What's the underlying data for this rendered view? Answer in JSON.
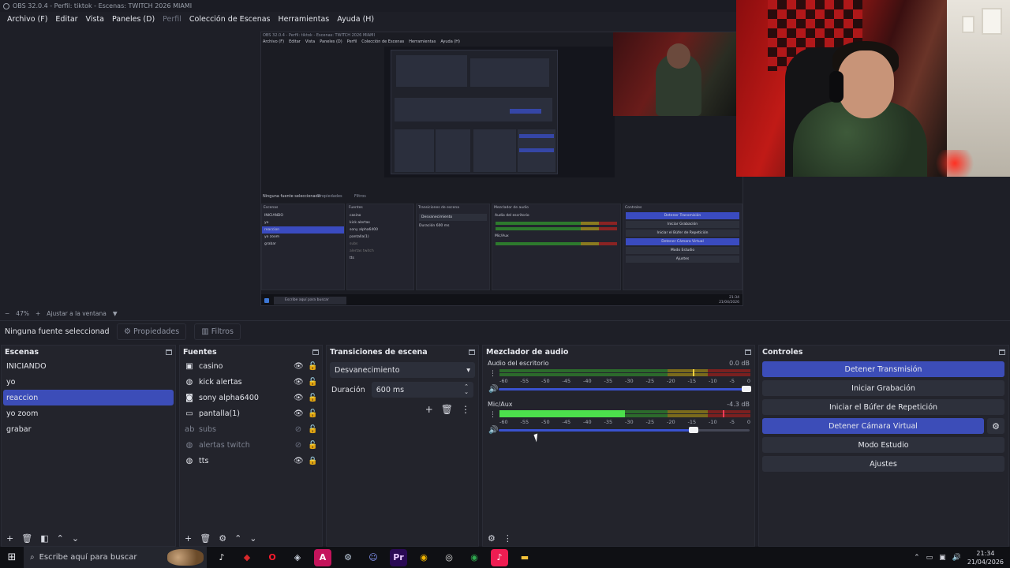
{
  "window": {
    "title": "OBS 32.0.4 - Perfil: tiktok - Escenas: TWITCH 2026 MIAMI"
  },
  "menu": [
    {
      "label": "Archivo (F)",
      "enabled": true
    },
    {
      "label": "Editar",
      "enabled": true
    },
    {
      "label": "Vista",
      "enabled": true
    },
    {
      "label": "Paneles (D)",
      "enabled": true
    },
    {
      "label": "Perfil",
      "enabled": false
    },
    {
      "label": "Colección de Escenas",
      "enabled": true
    },
    {
      "label": "Herramientas",
      "enabled": true
    },
    {
      "label": "Ayuda (H)",
      "enabled": true
    }
  ],
  "nested": {
    "title": "OBS 32.0.4 - Perfil: tiktok - Escenas: TWITCH 2026 MIAMI",
    "menu": [
      "Archivo (F)",
      "Editar",
      "Vista",
      "Paneles (D)",
      "Perfil",
      "Colección de Escenas",
      "Herramientas",
      "Ayuda (H)"
    ],
    "no_source": "Ninguna fuente seleccionada",
    "props": "Propiedades",
    "filters": "Filtros",
    "scenes_title": "Escenas",
    "scenes": [
      "INICIANDO",
      "yo",
      "reaccion",
      "yo zoom",
      "grabar"
    ],
    "sources_title": "Fuentes",
    "sources": [
      "casino",
      "kick alertas",
      "sony alpha6400",
      "pantalla(1)",
      "subs",
      "alertas twitch",
      "tts"
    ],
    "trans_title": "Transiciones de escena",
    "trans_value": "Desvanecimiento",
    "dur_label": "Duración",
    "dur_value": "600 ms",
    "mixer_title": "Mezclador de audio",
    "ch1": "Audio del escritorio",
    "ch2": "Mic/Aux",
    "controls_title": "Controles",
    "controls": [
      "Detener Transmisión",
      "Iniciar Grabación",
      "Iniciar el Búfer de Repetición",
      "Detener Cámara Virtual",
      "Modo Estudio",
      "Ajustes"
    ],
    "search": "Escribe aquí para buscar",
    "time": "21:34",
    "date": "21/04/2026"
  },
  "zoom": {
    "minus": "−",
    "value": "47%",
    "plus": "+",
    "fit": "Ajustar a la ventana",
    "caret": "▼"
  },
  "source_toolbar": {
    "status": "Ninguna fuente seleccionada",
    "properties": "Propiedades",
    "filters": "Filtros"
  },
  "scenes": {
    "title": "Escenas",
    "items": [
      "INICIANDO",
      "yo",
      "reaccion",
      "yo zoom",
      "grabar"
    ],
    "selected_index": 2
  },
  "sources": {
    "title": "Fuentes",
    "items": [
      {
        "name": "casino",
        "icon": "globe",
        "visible": true,
        "locked": false
      },
      {
        "name": "kick alertas",
        "icon": "globe",
        "visible": true,
        "locked": false
      },
      {
        "name": "sony alpha6400",
        "icon": "camera",
        "visible": true,
        "locked": false
      },
      {
        "name": "pantalla(1)",
        "icon": "monitor",
        "visible": true,
        "locked": false
      },
      {
        "name": "subs",
        "icon": "text",
        "visible": false,
        "locked": false
      },
      {
        "name": "alertas twitch",
        "icon": "globe",
        "visible": false,
        "locked": false
      },
      {
        "name": "tts",
        "icon": "globe",
        "visible": true,
        "locked": true
      }
    ]
  },
  "transitions": {
    "title": "Transiciones de escena",
    "type": "Desvanecimiento",
    "duration_label": "Duración",
    "duration_value": "600 ms"
  },
  "mixer": {
    "title": "Mezclador de audio",
    "ticks": [
      "-60",
      "-55",
      "-50",
      "-45",
      "-40",
      "-35",
      "-30",
      "-25",
      "-20",
      "-15",
      "-10",
      "-5",
      "0"
    ],
    "channels": [
      {
        "name": "Audio del escritorio",
        "db": "0.0 dB",
        "level": 0.0,
        "volume": 1.0
      },
      {
        "name": "Mic/Aux",
        "db": "-4.3 dB",
        "level": 0.5,
        "volume": 0.79
      }
    ]
  },
  "controls": {
    "title": "Controles",
    "stop_stream": "Detener Transmisión",
    "start_record": "Iniciar Grabación",
    "replay_buffer": "Iniciar el Búfer de Repetición",
    "stop_vcam": "Detener Cámara Virtual",
    "studio_mode": "Modo Estudio",
    "settings": "Ajustes"
  },
  "taskbar": {
    "search_placeholder": "Escribe aquí para buscar",
    "apps": [
      {
        "name": "tiktok",
        "glyph": "♪",
        "color": "#ffffff",
        "bg": "transparent"
      },
      {
        "name": "razer",
        "glyph": "◆",
        "color": "#d8282b",
        "bg": "transparent"
      },
      {
        "name": "opera",
        "glyph": "O",
        "color": "#ff1b2d",
        "bg": "transparent"
      },
      {
        "name": "app",
        "glyph": "◈",
        "color": "#c8d0dc",
        "bg": "transparent"
      },
      {
        "name": "affinity",
        "glyph": "A",
        "color": "#ffffff",
        "bg": "#c4145b"
      },
      {
        "name": "steam",
        "glyph": "⚙",
        "color": "#c8d8ea",
        "bg": "transparent"
      },
      {
        "name": "discord",
        "glyph": "☺",
        "color": "#8a9cff",
        "bg": "transparent"
      },
      {
        "name": "premiere",
        "glyph": "Pr",
        "color": "#e7c9ff",
        "bg": "#2a0a55"
      },
      {
        "name": "chrome",
        "glyph": "◉",
        "color": "#f0b400",
        "bg": "transparent"
      },
      {
        "name": "obs",
        "glyph": "◎",
        "color": "#e6e6e6",
        "bg": "transparent"
      },
      {
        "name": "chrome-2",
        "glyph": "◉",
        "color": "#2fa84f",
        "bg": "transparent"
      },
      {
        "name": "tiktok-2",
        "glyph": "♪",
        "color": "#ffffff",
        "bg": "#ee1d52"
      },
      {
        "name": "explorer",
        "glyph": "▬",
        "color": "#f4c23a",
        "bg": "transparent"
      }
    ],
    "time": "21:34",
    "date": "21/04/2026"
  }
}
